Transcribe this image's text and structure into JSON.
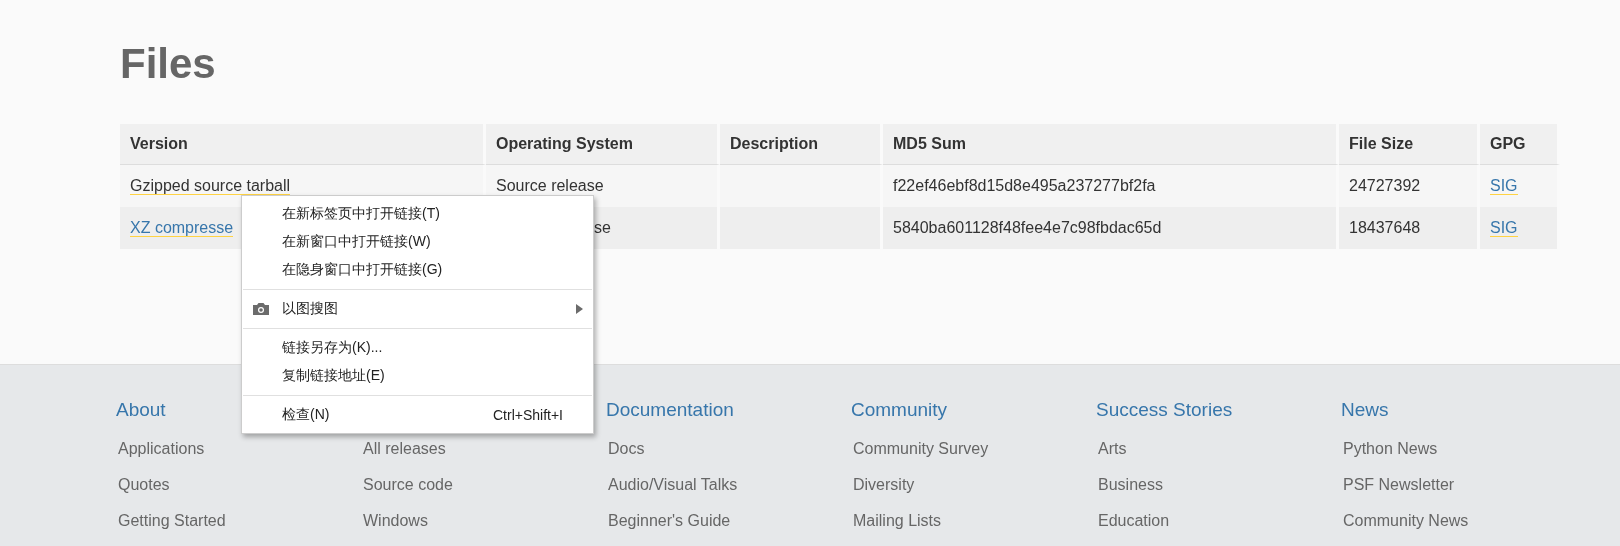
{
  "heading": "Files",
  "table": {
    "columns": [
      "Version",
      "Operating System",
      "Description",
      "MD5 Sum",
      "File Size",
      "GPG"
    ],
    "rows": [
      {
        "cells": [
          {
            "text": "Gzipped source tarball",
            "link": true
          },
          {
            "text": "Source release",
            "link": false
          },
          null,
          {
            "text": "f22ef46ebf8d15d8e495a237277bf2fa",
            "link": false
          },
          {
            "text": "24727392",
            "link": false
          },
          {
            "text": "SIG",
            "link": true
          }
        ]
      },
      {
        "cells": [
          {
            "text": "XZ compresse",
            "link": true
          },
          {
            "text": "se",
            "link": false
          },
          null,
          {
            "text": "5840ba601128f48fee4e7c98fbdac65d",
            "link": false
          },
          {
            "text": "18437648",
            "link": false
          },
          {
            "text": "SIG",
            "link": true
          }
        ]
      }
    ]
  },
  "footer": [
    {
      "title": "About",
      "items": [
        "Applications",
        "Quotes",
        "Getting Started"
      ]
    },
    {
      "items": [
        "All releases",
        "Source code",
        "Windows"
      ]
    },
    {
      "title": "Documentation",
      "items": [
        "Docs",
        "Audio/Visual Talks",
        "Beginner's Guide"
      ]
    },
    {
      "title": "Community",
      "items": [
        "Community Survey",
        "Diversity",
        "Mailing Lists"
      ]
    },
    {
      "title": "Success Stories",
      "items": [
        "Arts",
        "Business",
        "Education"
      ]
    },
    {
      "title": "News",
      "items": [
        "Python News",
        "PSF Newsletter",
        "Community News"
      ]
    }
  ],
  "context_menu": [
    {
      "kind": "item",
      "label": "在新标签页中打开链接(T)"
    },
    {
      "kind": "item",
      "label": "在新窗口中打开链接(W)"
    },
    {
      "kind": "item",
      "label": "在隐身窗口中打开链接(G)"
    },
    {
      "kind": "separator"
    },
    {
      "kind": "submenu",
      "label": "以图搜图"
    },
    {
      "kind": "separator"
    },
    {
      "kind": "item",
      "label": "链接另存为(K)..."
    },
    {
      "kind": "item",
      "label": "复制链接地址(E)"
    },
    {
      "kind": "separator"
    },
    {
      "kind": "item",
      "label": "检查(N)",
      "shortcut": "Ctrl+Shift+I"
    }
  ]
}
